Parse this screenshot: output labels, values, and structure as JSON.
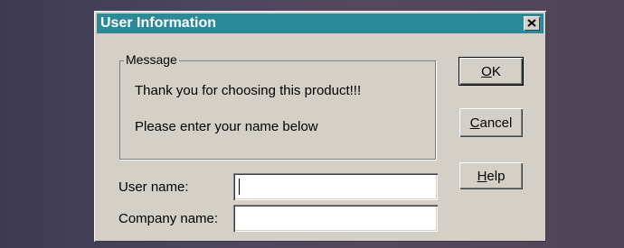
{
  "window": {
    "title": "User Information",
    "close_glyph": "✕"
  },
  "message_group": {
    "legend": "Message",
    "line1": "Thank you for choosing this product!!!",
    "line2": "Please enter your name below"
  },
  "form": {
    "user_name_label": "User name:",
    "user_name_value": "",
    "company_name_label": "Company name:",
    "company_name_value": ""
  },
  "buttons": {
    "ok": {
      "mnemonic": "O",
      "rest": "K"
    },
    "cancel": {
      "mnemonic": "C",
      "rest": "ancel"
    },
    "help": {
      "mnemonic": "H",
      "rest": "elp"
    }
  },
  "colors": {
    "titlebar": "#2b8a99",
    "dialog_face": "#d4d0c8",
    "backdrop": "#4a4358"
  }
}
